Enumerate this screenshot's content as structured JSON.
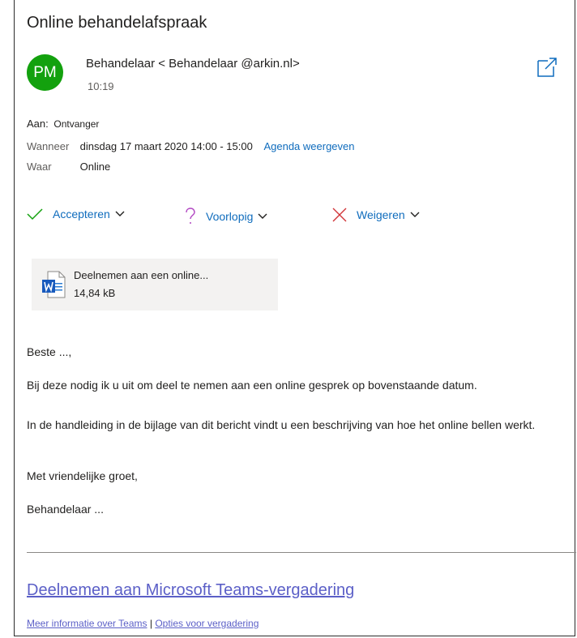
{
  "email": {
    "subject": "Online behandelafspraak",
    "avatar_initials": "PM",
    "sender": "Behandelaar  < Behandelaar @arkin.nl>",
    "time": "10:19",
    "to_label": "Aan:",
    "to_value": "Ontvanger",
    "when_label": "Wanneer",
    "when_value": "dinsdag 17 maart 2020 14:00 - 15:00",
    "calendar_link": "Agenda weergeven",
    "where_label": "Waar",
    "where_value": "Online"
  },
  "responses": {
    "accept": "Accepteren",
    "tentative": "Voorlopig",
    "decline": "Weigeren"
  },
  "attachment": {
    "name": "Deelnemen aan een online...",
    "size": "14,84 kB",
    "icon": "word-document-icon"
  },
  "body": {
    "greeting": "Beste ...,",
    "p1": "Bij deze nodig ik u uit om deel te nemen aan een online gesprek op bovenstaande datum.",
    "p2": "In de handleiding in de bijlage van dit bericht vindt u een beschrijving van hoe het online bellen werkt.",
    "closing": "Met vriendelijke groet,",
    "signature": "Behandelaar ..."
  },
  "teams": {
    "join_link": "Deelnemen aan Microsoft Teams-vergadering",
    "more_info": "Meer informatie over Teams",
    "separator": "|",
    "options": "Opties voor vergadering"
  },
  "colors": {
    "avatar": "#13a10e",
    "link": "#0f6cbd",
    "teams": "#5b5fc7",
    "accept": "#13a10e",
    "tentative": "#b146c2",
    "decline": "#d13438"
  }
}
